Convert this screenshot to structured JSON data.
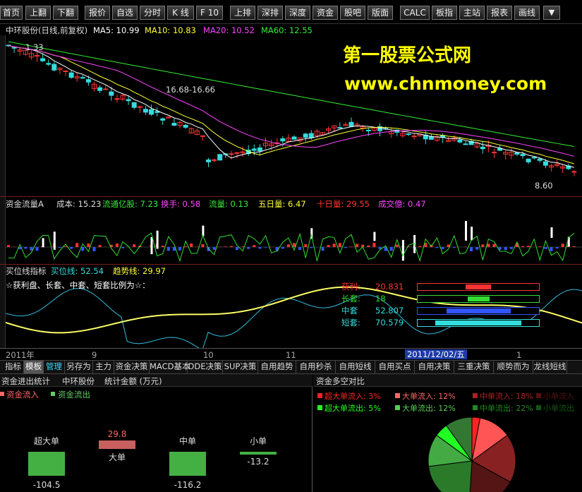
{
  "toolbar": {
    "buttons": [
      "首页",
      "上翻",
      "下翻",
      "报价",
      "自选",
      "分时",
      "K 线",
      "F 10",
      "上排",
      "深排",
      "深度",
      "资金",
      "股吧",
      "版面",
      "CALC",
      "板指",
      "主站",
      "报表",
      "画线"
    ]
  },
  "stock_header": {
    "title": "中环股份(日线,前复权)",
    "ma5": "MA5: 10.99",
    "ma10": "MA10: 10.83",
    "ma20": "MA20: 10.52",
    "ma60": "MA60: 12.55"
  },
  "watermark": {
    "line1": "第一股票公式网",
    "line2": "www.chnmoney.com"
  },
  "price_annotations": {
    "high": "1.33",
    "mid": "16.68-16.66",
    "low": "8.60"
  },
  "flow_indicator": {
    "name": "资金流量A",
    "cost": "成本: 15.23",
    "circ_cap": "流通亿股: 7.23",
    "turnover": "换手: 0.58",
    "flow": "流量: 0.13",
    "five_day": "五日量: 6.47",
    "ten_day": "十日量: 29.55",
    "deal": "成交億: 0.47"
  },
  "buy_indicator": {
    "name": "买位线指标",
    "buy_line": "买位线: 52.54",
    "trend_line": "趋势线: 29.97",
    "subtitle": "☆获利盘、长套、中套、短套比例为☆："
  },
  "ratios": [
    {
      "label": "获利:",
      "value": "20.831",
      "color": "#ff3333",
      "fill": 0.21
    },
    {
      "label": "长套:",
      "value": "18",
      "color": "#33dd33",
      "fill": 0.18
    },
    {
      "label": "中套",
      "value": "52.807",
      "color": "#3355ff",
      "fill": 0.53
    },
    {
      "label": "短套:",
      "value": "70.579",
      "color": "#33dddd",
      "fill": 0.71
    }
  ],
  "time_axis": {
    "labels": [
      "2011年",
      "9",
      "10",
      "11",
      "2011/12/02/五",
      "1"
    ]
  },
  "tabs": [
    "指标",
    "模板",
    "管理",
    "另存为",
    "主力",
    "资金决策",
    "MACD基本",
    "DDE决策",
    "SUP决策",
    "自用趋势",
    "自用秒杀",
    "自用短线",
    "自用买点",
    "自用决策",
    "三重决策",
    "顺势而为",
    "龙线短线"
  ],
  "flow_stats": {
    "title": "资金进出统计",
    "stock": "中环股份",
    "unit": "统计金额 (万元)",
    "legend_in": "资金流入",
    "legend_out": "资金流出",
    "bars": [
      {
        "label": "超大单",
        "value": "-104.5"
      },
      {
        "label": "大单",
        "value": "29.8"
      },
      {
        "label": "中单",
        "value": "-116.2"
      },
      {
        "label": "小单",
        "value": "-13.2"
      }
    ]
  },
  "pie_panel": {
    "title": "资金多空对比",
    "inflow": [
      {
        "label": "超大单流入:",
        "value": "3%",
        "color": "#ff2222"
      },
      {
        "label": "大单流入:",
        "value": "12%",
        "color": "#ff6666"
      },
      {
        "label": "中单流入:",
        "value": "18%",
        "color": "#aa2222"
      },
      {
        "label": "小单流入",
        "value": "",
        "color": "#551111"
      }
    ],
    "outflow": [
      {
        "label": "超大单流出:",
        "value": "5%",
        "color": "#22ff22"
      },
      {
        "label": "大单流出:",
        "value": "12%",
        "color": "#55cc55"
      },
      {
        "label": "中单流出:",
        "value": "22%",
        "color": "#228822"
      },
      {
        "label": "小单流出",
        "value": "",
        "color": "#115511"
      }
    ]
  },
  "colors": {
    "ma5": "#ffffff",
    "ma10": "#ffff33",
    "ma20": "#ff44ff",
    "ma60": "#33ee33",
    "up": "#ff3333",
    "down": "#33dddd"
  }
}
